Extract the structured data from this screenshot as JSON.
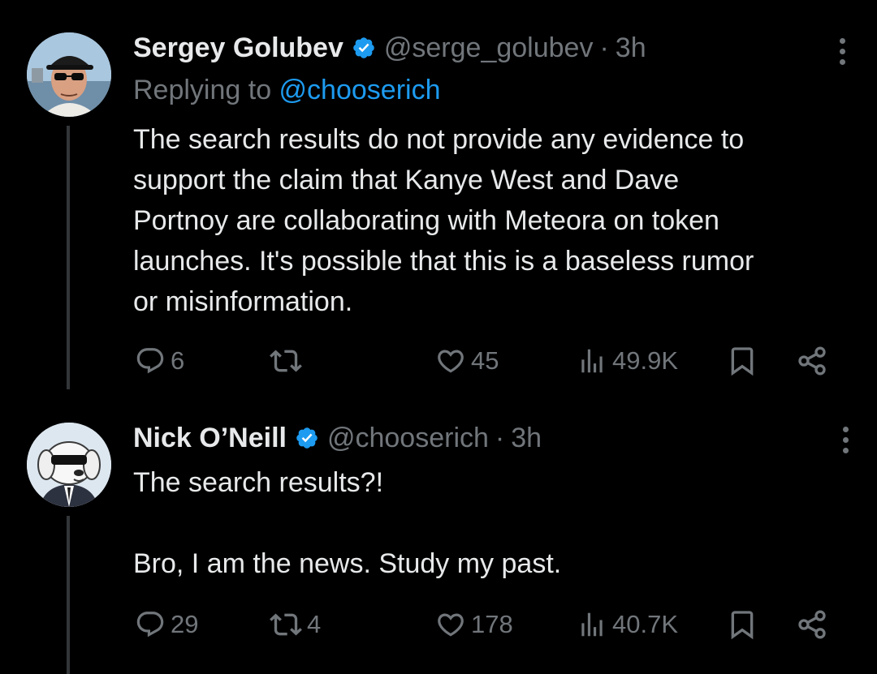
{
  "tweets": [
    {
      "author": {
        "name": "Sergey Golubev",
        "handle": "@serge_golubev",
        "time": "3h",
        "verified": true,
        "avatar": "man-with-sunglasses-avatar"
      },
      "replying_prefix": "Replying to ",
      "replying_to": "@chooserich",
      "text": "The search results do not provide any evidence to\nsupport the claim that Kanye West and Dave\nPortnoy are collaborating with Meteora on token\nlaunches. It's possible that this is a baseless rumor\nor misinformation.",
      "stats": {
        "replies": "6",
        "retweets": "",
        "likes": "45",
        "views": "49.9K"
      }
    },
    {
      "author": {
        "name": "Nick O’Neill",
        "handle": "@chooserich",
        "time": "3h",
        "verified": true,
        "avatar": "cartoon-dog-in-suit-avatar"
      },
      "text": "The search results?!\n\nBro, I am the news. Study my past.",
      "stats": {
        "replies": "29",
        "retweets": "4",
        "likes": "178",
        "views": "40.7K"
      }
    }
  ],
  "separator": "·",
  "colors": {
    "background": "#000000",
    "text": "#e7e9ea",
    "muted": "#71767b",
    "link": "#1d9bf0",
    "verified": "#1d9bf0"
  }
}
